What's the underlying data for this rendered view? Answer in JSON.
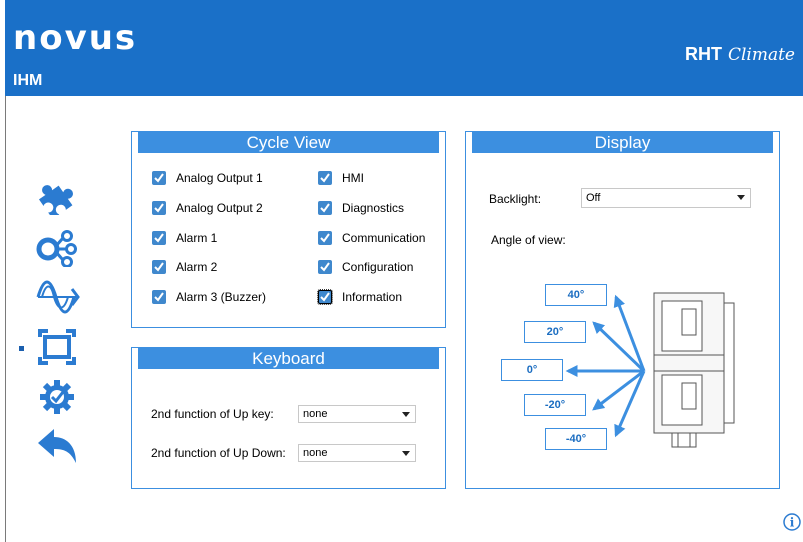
{
  "header": {
    "logo": "novus",
    "section": "IHM",
    "product": "RHT",
    "product_script": "Climate"
  },
  "sidebar": {
    "items": [
      {
        "icon": "puzzle-icon"
      },
      {
        "icon": "share-nodes-icon"
      },
      {
        "icon": "sine-wave-icon"
      },
      {
        "icon": "display-frame-icon",
        "selected": true
      },
      {
        "icon": "gear-check-icon"
      },
      {
        "icon": "back-arrow-icon"
      }
    ]
  },
  "cycle_view": {
    "title": "Cycle View",
    "left": [
      {
        "label": "Analog Output 1",
        "checked": true
      },
      {
        "label": "Analog Output 2",
        "checked": true
      },
      {
        "label": "Alarm 1",
        "checked": true
      },
      {
        "label": "Alarm 2",
        "checked": true
      },
      {
        "label": "Alarm 3 (Buzzer)",
        "checked": true
      }
    ],
    "right": [
      {
        "label": "HMI",
        "checked": true
      },
      {
        "label": "Diagnostics",
        "checked": true
      },
      {
        "label": "Communication",
        "checked": true
      },
      {
        "label": "Configuration",
        "checked": true
      },
      {
        "label": "Information",
        "checked": true
      }
    ]
  },
  "keyboard": {
    "title": "Keyboard",
    "up_key_label": "2nd function of Up key:",
    "up_key_value": "none",
    "up_down_label": "2nd function of Up Down:",
    "up_down_value": "none"
  },
  "display": {
    "title": "Display",
    "backlight_label": "Backlight:",
    "backlight_value": "Off",
    "angle_label": "Angle of view:",
    "angles": [
      "40°",
      "20°",
      "0°",
      "-20°",
      "-40°"
    ]
  },
  "colors": {
    "header": "#1a70c8",
    "accent": "#3c8fe0",
    "checkbox": "#3f88cd"
  }
}
